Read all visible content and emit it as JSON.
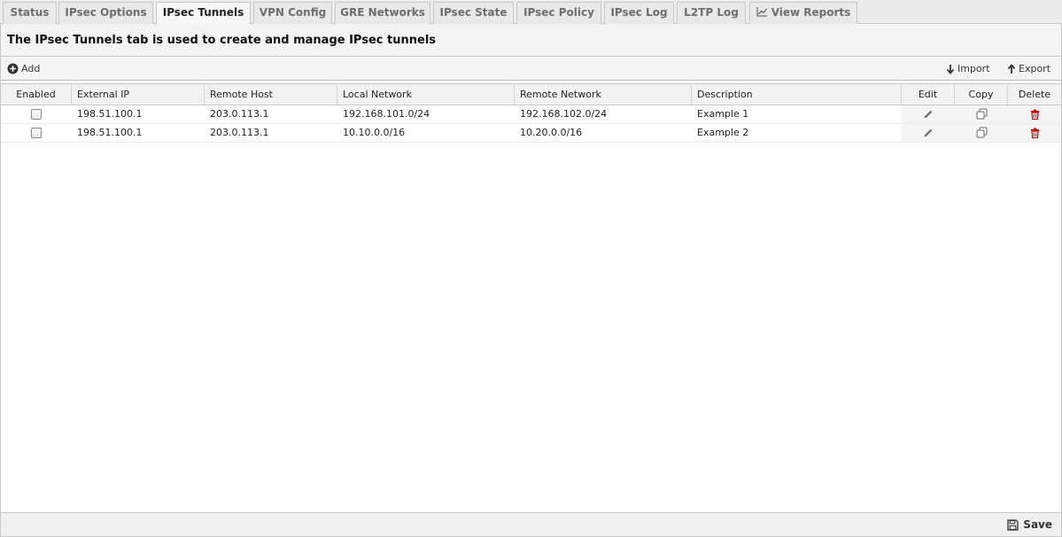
{
  "tabs": [
    {
      "label": "Status"
    },
    {
      "label": "IPsec Options"
    },
    {
      "label": "IPsec Tunnels",
      "active": true
    },
    {
      "label": "VPN Config"
    },
    {
      "label": "GRE Networks"
    },
    {
      "label": "IPsec State"
    },
    {
      "label": "IPsec Policy"
    },
    {
      "label": "IPsec Log"
    },
    {
      "label": "L2TP Log"
    },
    {
      "label": "View Reports",
      "icon": "chart-line-icon"
    }
  ],
  "heading": "The IPsec Tunnels tab is used to create and manage IPsec tunnels",
  "toolbar": {
    "add_label": "Add",
    "import_label": "Import",
    "export_label": "Export"
  },
  "table": {
    "headers": {
      "enabled": "Enabled",
      "external_ip": "External IP",
      "remote_host": "Remote Host",
      "local_network": "Local Network",
      "remote_network": "Remote Network",
      "description": "Description",
      "edit": "Edit",
      "copy": "Copy",
      "delete": "Delete"
    },
    "rows": [
      {
        "enabled": false,
        "external_ip": "198.51.100.1",
        "remote_host": "203.0.113.1",
        "local_network": "192.168.101.0/24",
        "remote_network": "192.168.102.0/24",
        "description": "Example 1"
      },
      {
        "enabled": false,
        "external_ip": "198.51.100.1",
        "remote_host": "203.0.113.1",
        "local_network": "10.10.0.0/16",
        "remote_network": "10.20.0.0/16",
        "description": "Example 2"
      }
    ]
  },
  "footer": {
    "save_label": "Save"
  },
  "colors": {
    "delete_icon": "#cc0000",
    "active_tab": "#f7f7f7"
  }
}
